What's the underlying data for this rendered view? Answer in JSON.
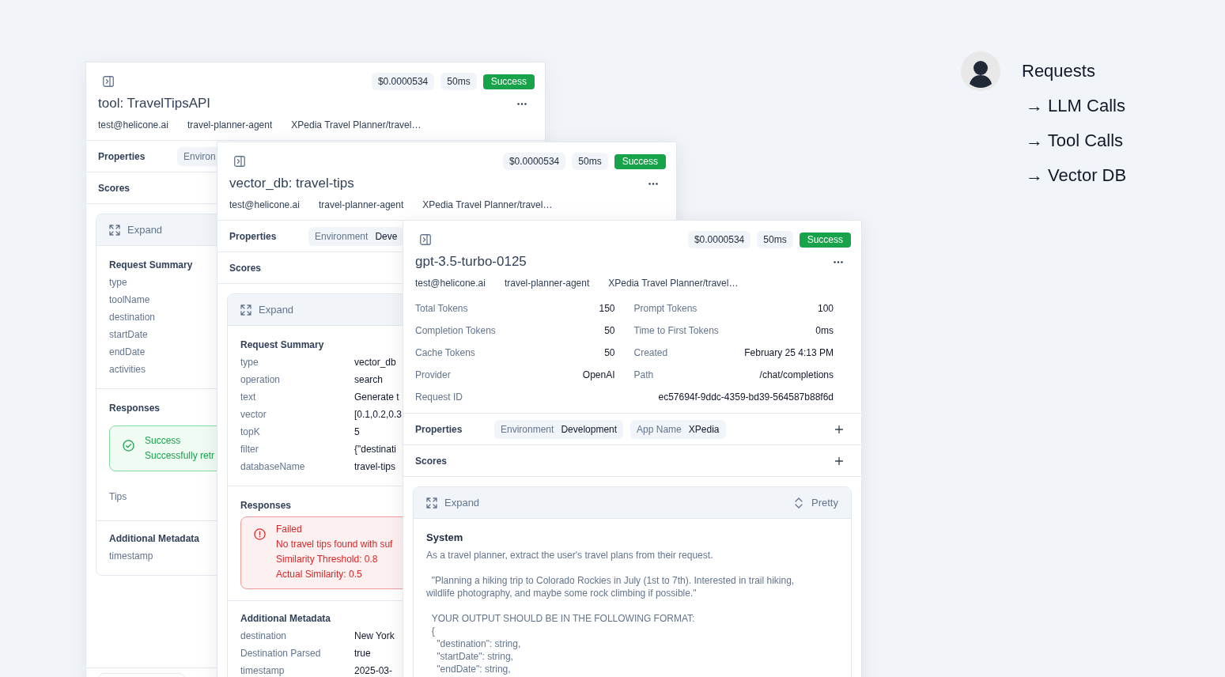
{
  "cards": [
    {
      "header": {
        "cost": "$0.0000534",
        "latency": "50ms",
        "status": {
          "label": "Success",
          "kind": "success"
        },
        "title": "tool: TravelTipsAPI",
        "meta": [
          "test@helicone.ai",
          "travel-planner-agent",
          "XPedia Travel Planner/travel…"
        ]
      },
      "properties": {
        "label": "Properties",
        "chips": [
          {
            "key": "Environ"
          }
        ]
      },
      "scores": {
        "label": "Scores"
      },
      "panel": {
        "expand": "Expand",
        "sections": [
          {
            "kind": "fields",
            "title": "Request Summary",
            "rows": [
              {
                "key": "type"
              },
              {
                "key": "toolName"
              },
              {
                "key": "destination"
              },
              {
                "key": "startDate"
              },
              {
                "key": "endDate"
              },
              {
                "key": "activities"
              }
            ]
          },
          {
            "kind": "responses",
            "title": "Responses",
            "items": [
              {
                "kind": "success",
                "title": "Success",
                "lines": [
                  "Successfully retr"
                ]
              }
            ],
            "note": "Tips"
          },
          {
            "kind": "fields",
            "title": "Additional Metadata",
            "rows": [
              {
                "key": "timestamp"
              }
            ]
          }
        ]
      },
      "footer": true
    },
    {
      "header": {
        "cost": "$0.0000534",
        "latency": "50ms",
        "status": {
          "label": "Success",
          "kind": "success"
        },
        "title": "vector_db: travel-tips",
        "meta": [
          "test@helicone.ai",
          "travel-planner-agent",
          "XPedia Travel Planner/travel…"
        ]
      },
      "properties": {
        "label": "Properties",
        "chips": [
          {
            "key": "Environment",
            "value": "Deve"
          }
        ]
      },
      "scores": {
        "label": "Scores"
      },
      "panel": {
        "expand": "Expand",
        "sections": [
          {
            "kind": "fields",
            "title": "Request Summary",
            "rows": [
              {
                "key": "type",
                "value": "vector_db"
              },
              {
                "key": "operation",
                "value": "search"
              },
              {
                "key": "text",
                "value": "Generate t"
              },
              {
                "key": "vector",
                "value": "[0.1,0.2,0.3"
              },
              {
                "key": "topK",
                "value": "5"
              },
              {
                "key": "filter",
                "value": "{\"destinati"
              },
              {
                "key": "databaseName",
                "value": "travel-tips"
              }
            ]
          },
          {
            "kind": "responses",
            "title": "Responses",
            "items": [
              {
                "kind": "error",
                "title": "Failed",
                "lines": [
                  "No travel tips found with suf",
                  "Similarity Threshold: 0.8",
                  "Actual Similarity: 0.5"
                ]
              }
            ]
          },
          {
            "kind": "fields",
            "title": "Additional Metadata",
            "rows": [
              {
                "key": "destination",
                "value": "New York"
              },
              {
                "key": "Destination Parsed",
                "value": "true"
              },
              {
                "key": "timestamp",
                "value": "2025-03-"
              }
            ]
          }
        ]
      }
    },
    {
      "header": {
        "cost": "$0.0000534",
        "latency": "50ms",
        "status": {
          "label": "Success",
          "kind": "success"
        },
        "title": "gpt-3.5-turbo-0125",
        "meta": [
          "test@helicone.ai",
          "travel-planner-agent",
          "XPedia Travel Planner/travel…"
        ]
      },
      "stats": [
        {
          "label": "Total Tokens",
          "value": "150"
        },
        {
          "label": "Prompt Tokens",
          "value": "100"
        },
        {
          "label": "Completion Tokens",
          "value": "50"
        },
        {
          "label": "Time to First Tokens",
          "value": "0ms"
        },
        {
          "label": "Cache Tokens",
          "value": "50"
        },
        {
          "label": "Created",
          "value": "February 25 4:13 PM"
        },
        {
          "label": "Provider",
          "value": "OpenAI"
        },
        {
          "label": "Path",
          "value": "/chat/completions"
        }
      ],
      "request_id": {
        "label": "Request ID",
        "value": "ec57694f-9ddc-4359-bd39-564587b88f6d"
      },
      "properties": {
        "label": "Properties",
        "chips": [
          {
            "key": "Environment",
            "value": "Development"
          },
          {
            "key": "App Name",
            "value": "XPedia"
          }
        ],
        "add_button": true
      },
      "scores": {
        "label": "Scores",
        "add_button": true
      },
      "panel": {
        "expand": "Expand",
        "format": "Pretty",
        "sections": [
          {
            "kind": "message",
            "role": "System",
            "text": "As a travel planner, extract the user's travel plans from their request.\n\n  \"Planning a hiking trip to Colorado Rockies in July (1st to 7th). Interested in trail hiking, wildlife photography, and maybe some rock climbing if possible.\"\n\n  YOUR OUTPUT SHOULD BE IN THE FOLLOWING FORMAT:\n  {\n    \"destination\": string,\n    \"startDate\": string,\n    \"endDate\": string,"
          }
        ]
      }
    }
  ],
  "legend": {
    "title": "Requests",
    "items": [
      {
        "label": "→ LLM Calls"
      },
      {
        "label": "→ Tool Calls"
      },
      {
        "label": "→ Vector DB"
      }
    ]
  }
}
